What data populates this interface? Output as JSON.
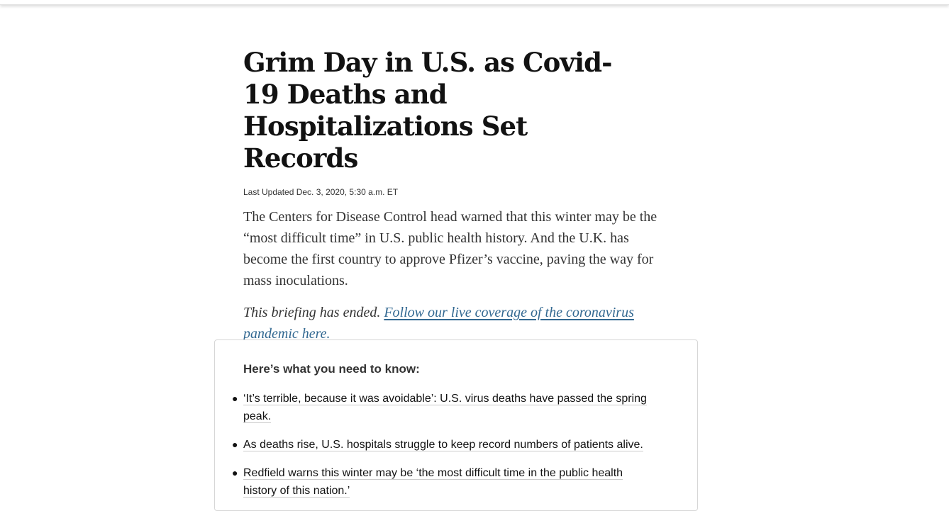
{
  "article": {
    "headline": "Grim Day in U.S. as Covid-19 Deaths and Hospitalizations Set Records",
    "timestamp": "Last Updated Dec. 3, 2020, 5:30 a.m. ET",
    "summary": "The Centers for Disease Control head warned that this winter may be the “most difficult time” in U.S. public health history. And the U.K. has become the first country to approve Pfizer’s vaccine, paving the way for mass inoculations.",
    "briefing_note": "This briefing has ended.",
    "briefing_link": "Follow our live coverage of the coronavirus pandemic here."
  },
  "know_box": {
    "title": "Here’s what you need to know:",
    "items": [
      {
        "text": "‘It’s terrible, because it was avoidable’: U.S. virus deaths have passed the spring peak."
      },
      {
        "text": "As deaths rise, U.S. hospitals struggle to keep record numbers of patients alive."
      },
      {
        "text": "Redfield warns this winter may be ‘the most difficult time in the public health history of this nation.’"
      }
    ]
  },
  "colors": {
    "link": "#326891",
    "headline": "#121212",
    "body_text": "#333333",
    "box_border": "#d6d6d6"
  }
}
